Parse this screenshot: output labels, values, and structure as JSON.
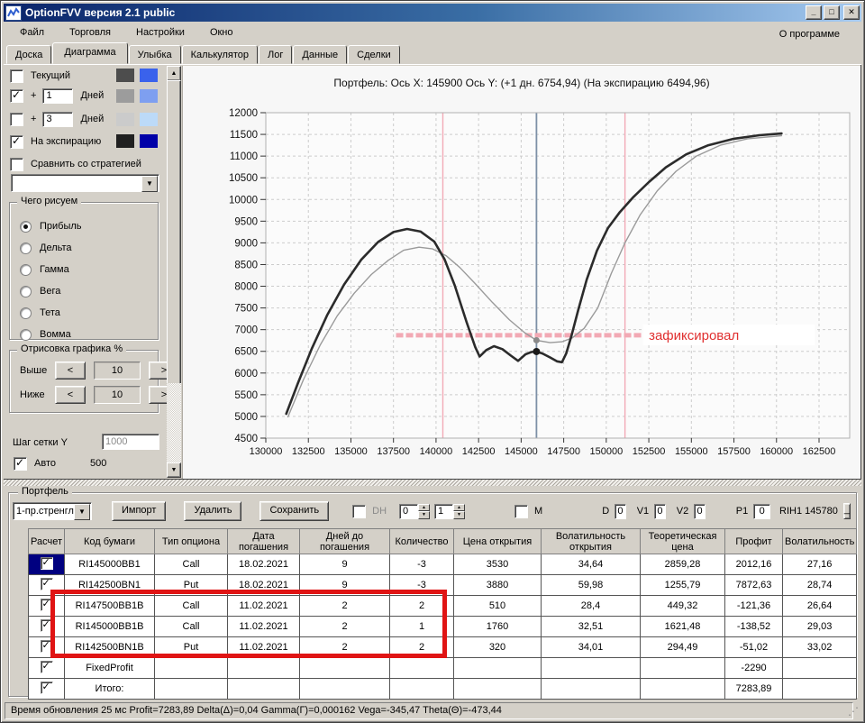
{
  "window": {
    "title": "OptionFVV версия 2.1 public"
  },
  "menu": {
    "items": [
      "Файл",
      "Торговля",
      "Настройки",
      "Окно"
    ],
    "right_item": "О программе"
  },
  "tabs": {
    "items": [
      "Доска",
      "Диаграмма",
      "Улыбка",
      "Калькулятор",
      "Лог",
      "Данные",
      "Сделки"
    ],
    "active": "Диаграмма"
  },
  "sidebar": {
    "curve_rows": [
      {
        "label": "Текущий",
        "checked": false,
        "swatches": [
          "#4d4d4d",
          "#3a62ec"
        ]
      },
      {
        "prefix": "+",
        "days": "1",
        "label": "Дней",
        "checked": true,
        "swatches": [
          "#9c9c9c",
          "#7e9ff0"
        ]
      },
      {
        "prefix": "+",
        "days": "3",
        "label": "Дней",
        "checked": false,
        "swatches": [
          "#cbcbcb",
          "#bcdaf8"
        ]
      },
      {
        "label": "На экспирацию",
        "checked": true,
        "swatches": [
          "#202020",
          "#0000a8"
        ]
      }
    ],
    "compare_label": "Сравнить со стратегией",
    "strategy_dropdown_value": "",
    "draw_group": {
      "title": "Чего рисуем",
      "options": [
        "Прибыль",
        "Дельта",
        "Гамма",
        "Вега",
        "Тета",
        "Вомма"
      ],
      "selected": "Прибыль"
    },
    "render_group": {
      "title": "Отрисовка графика %",
      "rows": [
        {
          "label": "Выше",
          "value": "10"
        },
        {
          "label": "Ниже",
          "value": "10"
        }
      ]
    },
    "grid_step": {
      "label": "Шаг сетки Y",
      "value": "1000",
      "auto_label": "Авто",
      "auto_checked": true,
      "auto_value": "500"
    }
  },
  "chart": {
    "title": "Портфель: Ось X: 145900 Ось Y:  (+1 дн. 6754,94)  (На экспирацию 6494,96)"
  },
  "chart_data": {
    "type": "line",
    "title": "Портфель: Ось X: 145900 Ось Y:  (+1 дн. 6754,94)  (На экспирацию 6494,96)",
    "xlim": [
      130000,
      164300
    ],
    "ylim": [
      4500,
      12000
    ],
    "x_ticks": [
      130000,
      132500,
      135000,
      137500,
      140000,
      142500,
      145000,
      147500,
      150000,
      152500,
      155000,
      157500,
      160000,
      162500
    ],
    "y_tick_step": 500,
    "grid": true,
    "series": [
      {
        "name": "+1 день",
        "color": "#9a9a9a",
        "width": 1.4,
        "points": [
          [
            131300,
            4990
          ],
          [
            132200,
            5840
          ],
          [
            133200,
            6650
          ],
          [
            134200,
            7320
          ],
          [
            135200,
            7840
          ],
          [
            136200,
            8270
          ],
          [
            137200,
            8600
          ],
          [
            138100,
            8830
          ],
          [
            139000,
            8900
          ],
          [
            139800,
            8860
          ],
          [
            140600,
            8700
          ],
          [
            141400,
            8430
          ],
          [
            142300,
            8060
          ],
          [
            143300,
            7630
          ],
          [
            144300,
            7230
          ],
          [
            145200,
            6930
          ],
          [
            145900,
            6755
          ],
          [
            146700,
            6700
          ],
          [
            147400,
            6720
          ],
          [
            148000,
            6810
          ],
          [
            148700,
            7030
          ],
          [
            149500,
            7500
          ],
          [
            150300,
            8300
          ],
          [
            151100,
            9000
          ],
          [
            152000,
            9650
          ],
          [
            153000,
            10200
          ],
          [
            154100,
            10650
          ],
          [
            155300,
            11000
          ],
          [
            156700,
            11250
          ],
          [
            158300,
            11400
          ],
          [
            160300,
            11470
          ]
        ]
      },
      {
        "name": "На экспирацию",
        "color": "#2b2b2b",
        "width": 2.6,
        "points": [
          [
            131200,
            5060
          ],
          [
            131900,
            5780
          ],
          [
            132700,
            6560
          ],
          [
            133600,
            7330
          ],
          [
            134600,
            8040
          ],
          [
            135600,
            8610
          ],
          [
            136600,
            9020
          ],
          [
            137500,
            9250
          ],
          [
            138300,
            9320
          ],
          [
            139100,
            9260
          ],
          [
            139900,
            9030
          ],
          [
            140500,
            8620
          ],
          [
            141100,
            8020
          ],
          [
            141800,
            7170
          ],
          [
            142300,
            6600
          ],
          [
            142560,
            6380
          ],
          [
            142950,
            6530
          ],
          [
            143400,
            6620
          ],
          [
            143900,
            6550
          ],
          [
            144400,
            6400
          ],
          [
            144820,
            6280
          ],
          [
            145250,
            6430
          ],
          [
            145600,
            6485
          ],
          [
            145900,
            6495
          ],
          [
            146250,
            6450
          ],
          [
            146700,
            6360
          ],
          [
            147100,
            6270
          ],
          [
            147400,
            6250
          ],
          [
            147650,
            6450
          ],
          [
            147950,
            6850
          ],
          [
            148350,
            7450
          ],
          [
            148850,
            8150
          ],
          [
            149450,
            8820
          ],
          [
            150100,
            9340
          ],
          [
            150800,
            9710
          ],
          [
            151600,
            10060
          ],
          [
            152500,
            10400
          ],
          [
            153500,
            10740
          ],
          [
            154700,
            11040
          ],
          [
            156000,
            11250
          ],
          [
            157500,
            11400
          ],
          [
            159000,
            11480
          ],
          [
            160300,
            11520
          ]
        ]
      }
    ],
    "markers": [
      {
        "x": 145900,
        "y": 6755,
        "color": "#8a8a8a",
        "r": 3.5
      },
      {
        "x": 145900,
        "y": 6495,
        "color": "#1a1a1a",
        "r": 4
      }
    ],
    "vlines": [
      {
        "x": 140400,
        "color": "#f2aab6",
        "width": 1.4
      },
      {
        "x": 151100,
        "color": "#f2aab6",
        "width": 1.4
      },
      {
        "x": 145900,
        "color": "#7d90a6",
        "width": 1.8
      }
    ],
    "hline": {
      "y": 6870,
      "x1": 137650,
      "x2": 152100,
      "color": "#f2a9b4",
      "width": 5,
      "dash": "8 3"
    },
    "annotation": {
      "text": "зафиксировал",
      "x": 152500,
      "y": 6870,
      "color": "#e03030",
      "box_x1": 152150,
      "box_x2": 162250,
      "box_color": "#ffffff"
    }
  },
  "portfolio": {
    "group_title": "Портфель",
    "preset": "1-пр.стренгл",
    "buttons": [
      "Импорт",
      "Удалить",
      "Сохранить"
    ],
    "dh_label": "DH",
    "spin1": "0",
    "spin2": "1",
    "m_label": "М",
    "fields": [
      {
        "label": "D",
        "value": "0"
      },
      {
        "label": "V1",
        "value": "0"
      },
      {
        "label": "V2",
        "value": "0"
      },
      {
        "label": "P1",
        "value": "0"
      }
    ],
    "instrument": "RIH1 145780",
    "min_button": "_",
    "table": {
      "columns": [
        "Расчет",
        "Код бумаги",
        "Тип опциона",
        "Дата погашения",
        "Дней до погашения",
        "Количество",
        "Цена открытия",
        "Волатильность открытия",
        "Теоретическая цена",
        "Профит",
        "Волатильность"
      ],
      "profit_colors": {
        "green": "#90e890",
        "pink": "#f9a8b4"
      },
      "rows": [
        {
          "checked": true,
          "selected": true,
          "code": "RI145000BB1",
          "type": "Call",
          "date": "18.02.2021",
          "days": "9",
          "qty": "-3",
          "open": "3530",
          "open_vol": "34,64",
          "theo": "2859,28",
          "profit": "2012,16",
          "profit_color": "green",
          "vol": "27,16"
        },
        {
          "checked": true,
          "selected": false,
          "code": "RI142500BN1",
          "type": "Put",
          "date": "18.02.2021",
          "days": "9",
          "qty": "-3",
          "open": "3880",
          "open_vol": "59,98",
          "theo": "1255,79",
          "profit": "7872,63",
          "profit_color": "green",
          "vol": "28,74"
        },
        {
          "checked": true,
          "selected": false,
          "code": "RI147500BB1B",
          "type": "Call",
          "date": "11.02.2021",
          "days": "2",
          "qty": "2",
          "open": "510",
          "open_vol": "28,4",
          "theo": "449,32",
          "profit": "-121,36",
          "profit_color": "pink",
          "vol": "26,64"
        },
        {
          "checked": true,
          "selected": false,
          "code": "RI145000BB1B",
          "type": "Call",
          "date": "11.02.2021",
          "days": "2",
          "qty": "1",
          "open": "1760",
          "open_vol": "32,51",
          "theo": "1621,48",
          "profit": "-138,52",
          "profit_color": "pink",
          "vol": "29,03"
        },
        {
          "checked": true,
          "selected": false,
          "code": "RI142500BN1B",
          "type": "Put",
          "date": "11.02.2021",
          "days": "2",
          "qty": "2",
          "open": "320",
          "open_vol": "34,01",
          "theo": "294,49",
          "profit": "-51,02",
          "profit_color": "pink",
          "vol": "33,02"
        },
        {
          "checked": true,
          "selected": false,
          "code": "FixedProfit",
          "type": "",
          "date": "",
          "days": "",
          "qty": "",
          "open": "",
          "open_vol": "",
          "theo": "",
          "profit": "-2290",
          "profit_color": "pink",
          "vol": ""
        },
        {
          "checked": true,
          "selected": false,
          "code": "Итого:",
          "type": "",
          "date": "",
          "days": "",
          "qty": "",
          "open": "",
          "open_vol": "",
          "theo": "",
          "profit": "7283,89",
          "profit_color": "green",
          "vol": ""
        }
      ]
    }
  },
  "statusbar": {
    "text": "Время обновления 25 мс  Profit=7283,89 Delta(Δ)=0,04 Gamma(Г)=0,000162 Vega=-345,47 Theta(Θ)=-473,44"
  }
}
